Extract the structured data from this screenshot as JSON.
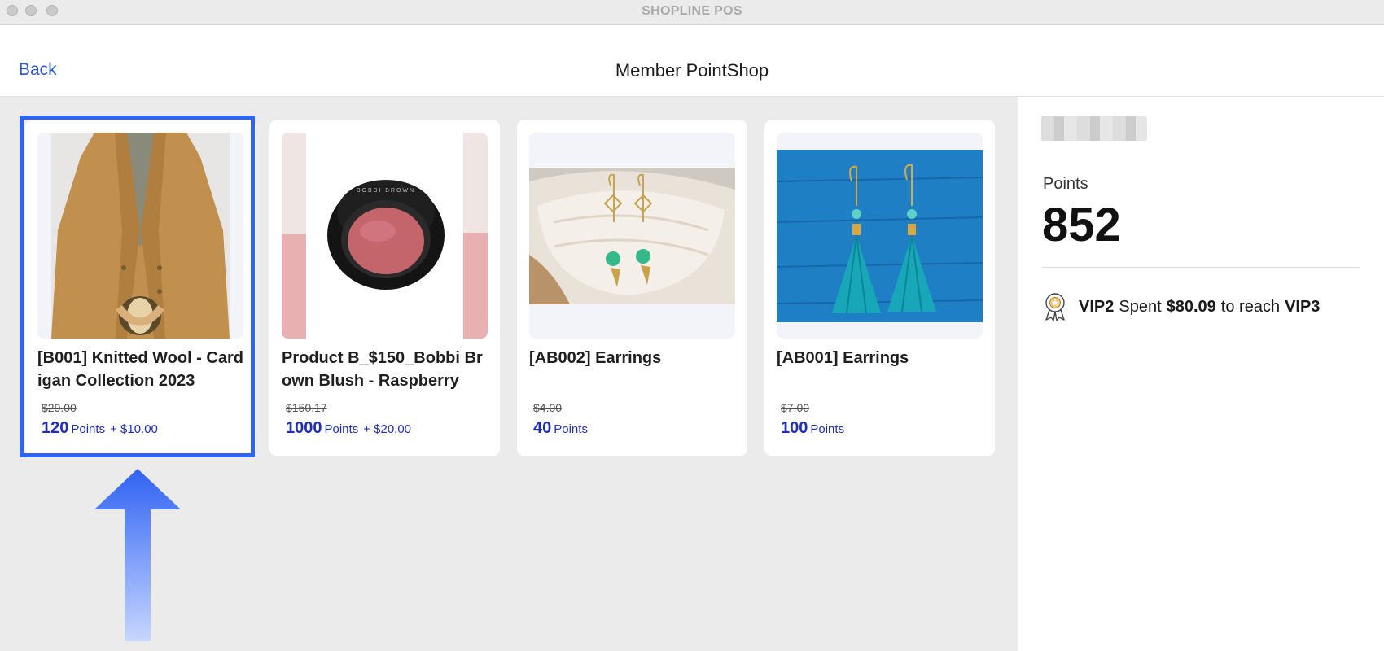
{
  "window": {
    "title": "SHOPLINE POS"
  },
  "header": {
    "back_label": "Back",
    "title": "Member PointShop"
  },
  "products": [
    {
      "name": "[B001] Knitted Wool - Cardigan Collection 2023",
      "original_price": "$29.00",
      "points": "120",
      "points_label": "Points",
      "cash": "+ $10.00",
      "image": "cardigan-photo"
    },
    {
      "name": "Product B_$150_Bobbi Brown Blush - Raspberry",
      "original_price": "$150.17",
      "points": "1000",
      "points_label": "Points",
      "cash": "+ $20.00",
      "image": "blush-compact-photo"
    },
    {
      "name": "[AB002] Earrings",
      "original_price": "$4.00",
      "points": "40",
      "points_label": "Points",
      "cash": "",
      "image": "earrings-shell-photo"
    },
    {
      "name": "[AB001] Earrings",
      "original_price": "$7.00",
      "points": "100",
      "points_label": "Points",
      "cash": "",
      "image": "tassel-earrings-photo"
    }
  ],
  "member": {
    "points_label": "Points",
    "points_value": "852",
    "vip_current": "VIP2",
    "vip_spent_text": "Spent",
    "vip_amount": "$80.09",
    "vip_to_reach_text": "to reach",
    "vip_next": "VIP3"
  },
  "colors": {
    "accent": "#2b55c9",
    "price_blue": "#1e2fb5",
    "highlight": "#2f63f3",
    "panel_bg": "#ebebeb"
  }
}
